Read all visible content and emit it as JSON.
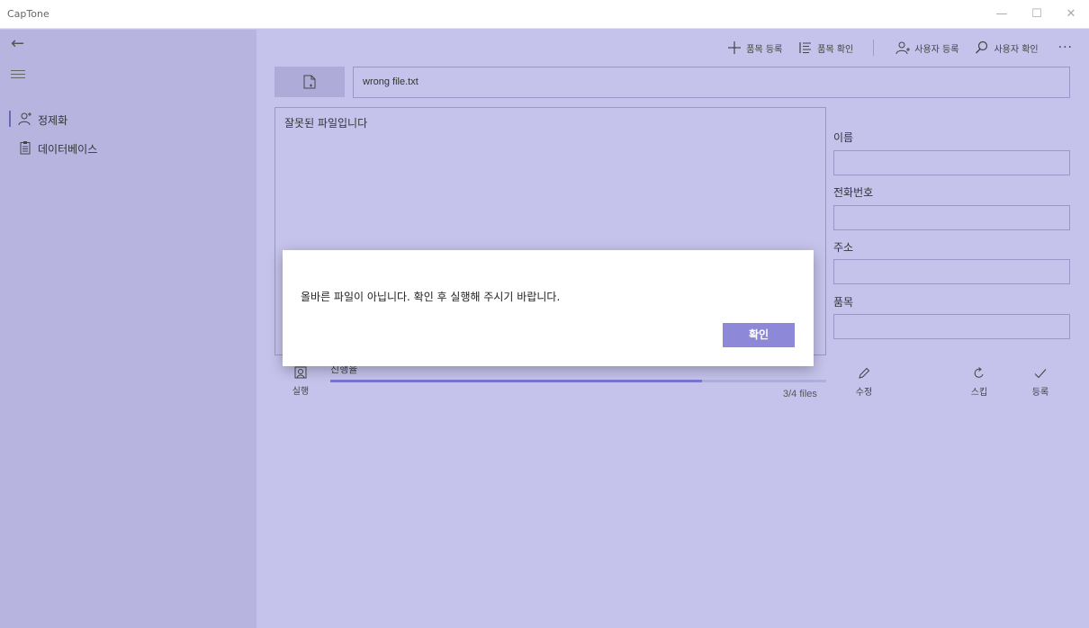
{
  "window": {
    "title": "CapTone",
    "controls": {
      "minimize": "—",
      "maximize": "☐",
      "close": "✕"
    }
  },
  "sidebar": {
    "back_icon": "←",
    "items": [
      {
        "label": "정제화",
        "icon": "user-clean-icon",
        "selected": true
      },
      {
        "label": "데이터베이스",
        "icon": "clipboard-icon",
        "selected": false
      }
    ]
  },
  "commands": {
    "add_item": "품목 등록",
    "view_items": "품목 확인",
    "add_user": "사용자 등록",
    "view_users": "사용자 확인",
    "more": "···"
  },
  "file": {
    "name": "wrong file.txt"
  },
  "content": {
    "text": "잘못된 파일입니다"
  },
  "form": {
    "name_label": "이름",
    "phone_label": "전화번호",
    "address_label": "주소",
    "item_label": "품목"
  },
  "progress": {
    "label": "진행율",
    "count_text": "3/4 files",
    "fraction": 0.75
  },
  "actions": {
    "run": "실행",
    "edit": "수정",
    "skip": "스킵",
    "register": "등록"
  },
  "dialog": {
    "message": "올바른 파일이 아닙니다. 확인 후 실행해 주시기 바랍니다.",
    "ok": "확인"
  },
  "colors": {
    "background": "#c5c3eb",
    "sidebar": "#b7b5e0",
    "accent": "#8d89d8",
    "progress": "#7a76cf"
  }
}
